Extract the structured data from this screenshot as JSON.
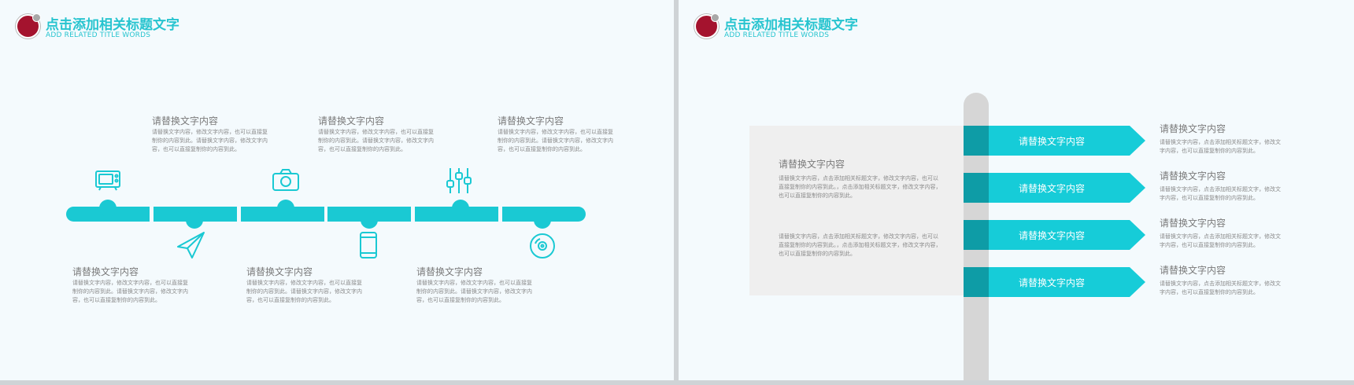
{
  "left_slide": {
    "title": "点击添加相关标题文字",
    "subtitle": "ADD RELATED TITLE WORDS",
    "icons": [
      "tv-icon",
      "paper-plane-icon",
      "camera-icon",
      "smartphone-icon",
      "equalizer-icon",
      "disc-icon"
    ],
    "top_items": [
      {
        "heading": "请替换文字内容",
        "lines": [
          "请替换文字内容，修改文字内容，也可以直接复",
          "制你的内容到此。请替换文字内容，修改文字内",
          "容，也可以直接复制你的内容到此。"
        ]
      },
      {
        "heading": "请替换文字内容",
        "lines": [
          "请替换文字内容，修改文字内容，也可以直接复",
          "制你的内容到此。请替换文字内容，修改文字内",
          "容，也可以直接复制你的内容到此。"
        ]
      },
      {
        "heading": "请替换文字内容",
        "lines": [
          "请替换文字内容，修改文字内容，也可以直接复",
          "制你的内容到此。请替换文字内容，修改文字内",
          "容，也可以直接复制你的内容到此。"
        ]
      }
    ],
    "bottom_items": [
      {
        "heading": "请替换文字内容",
        "lines": [
          "请替换文字内容，修改文字内容，也可以直接复",
          "制你的内容到此。请替换文字内容，修改文字内",
          "容，也可以直接复制你的内容到此。"
        ]
      },
      {
        "heading": "请替换文字内容",
        "lines": [
          "请替换文字内容，修改文字内容，也可以直接复",
          "制你的内容到此。请替换文字内容，修改文字内",
          "容，也可以直接复制你的内容到此。"
        ]
      },
      {
        "heading": "请替换文字内容",
        "lines": [
          "请替换文字内容，修改文字内容，也可以直接复",
          "制你的内容到此。请替换文字内容，修改文字内",
          "容，也可以直接复制你的内容到此。"
        ]
      }
    ]
  },
  "right_slide": {
    "title": "点击添加相关标题文字",
    "subtitle": "ADD RELATED TITLE WORDS",
    "panel": {
      "heading": "请替换文字内容",
      "paragraph_1": [
        "请替换文字内容，点击添加相关标题文字，修改文字内容，也可以",
        "直接复制你的内容到此。，点击添加相关标题文字，修改文字内容，",
        "也可以直接复制你的内容到此。"
      ],
      "paragraph_2": [
        "请替换文字内容，点击添加相关标题文字，修改文字内容，也可以",
        "直接复制你的内容到此。，点击添加相关标题文字，修改文字内容，",
        "也可以直接复制你的内容到此。"
      ]
    },
    "arrows": [
      {
        "label": "请替换文字内容"
      },
      {
        "label": "请替换文字内容"
      },
      {
        "label": "请替换文字内容"
      },
      {
        "label": "请替换文字内容"
      }
    ],
    "side_items": [
      {
        "heading": "请替换文字内容",
        "lines": [
          "请替换文字内容，点击添加相关标题文字，修改文",
          "字内容，也可以直接复制你的内容到此。"
        ]
      },
      {
        "heading": "请替换文字内容",
        "lines": [
          "请替换文字内容，点击添加相关标题文字，修改文",
          "字内容，也可以直接复制你的内容到此。"
        ]
      },
      {
        "heading": "请替换文字内容",
        "lines": [
          "请替换文字内容，点击添加相关标题文字，修改文",
          "字内容，也可以直接复制你的内容到此。"
        ]
      },
      {
        "heading": "请替换文字内容",
        "lines": [
          "请替换文字内容，点击添加相关标题文字，修改文",
          "字内容，也可以直接复制你的内容到此。"
        ]
      }
    ]
  },
  "colors": {
    "accent": "#1ac9d3",
    "accent_dark": "#0e9ca6",
    "logo": "#a4132e",
    "text": "#7a7a7a"
  }
}
